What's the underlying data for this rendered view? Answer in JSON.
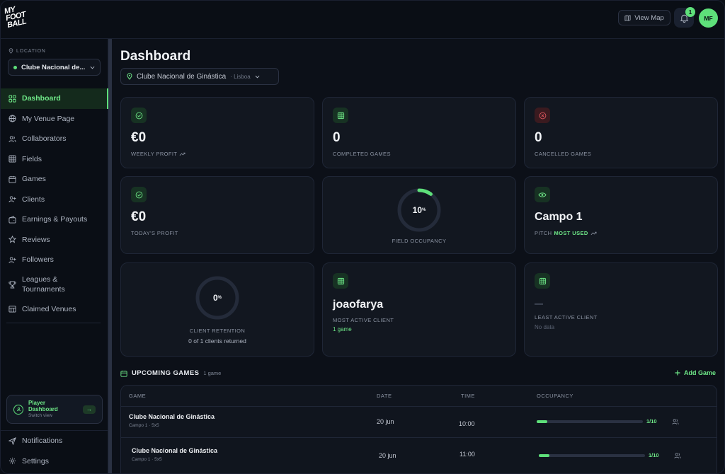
{
  "brand": {
    "logo_lines": [
      "MY",
      "FOOT",
      "BALL"
    ]
  },
  "topbar": {
    "view_map_label": "View Map",
    "notification_count": "1",
    "avatar_initials": "MF"
  },
  "sidebar": {
    "location_label": "LOCATION",
    "location_value": "Clube Nacional de...",
    "items": [
      {
        "label": "Dashboard",
        "icon": "grid-icon"
      },
      {
        "label": "My Venue Page",
        "icon": "globe-icon"
      },
      {
        "label": "Collaborators",
        "icon": "users-icon"
      },
      {
        "label": "Fields",
        "icon": "table-icon"
      },
      {
        "label": "Games",
        "icon": "calendar-icon"
      },
      {
        "label": "Clients",
        "icon": "user-plus-icon"
      },
      {
        "label": "Earnings & Payouts",
        "icon": "wallet-icon"
      },
      {
        "label": "Reviews",
        "icon": "star-icon"
      },
      {
        "label": "Followers",
        "icon": "user-add-icon"
      },
      {
        "label": "Leagues & Tournaments",
        "icon": "trophy-icon"
      },
      {
        "label": "Claimed Venues",
        "icon": "building-icon"
      }
    ],
    "player_card": {
      "title_line1": "Player",
      "title_line2": "Dashboard",
      "subtitle": "Switch view",
      "arrow": "→"
    },
    "bottom_items": [
      {
        "label": "Notifications",
        "icon": "send-icon"
      },
      {
        "label": "Settings",
        "icon": "gear-icon"
      }
    ]
  },
  "main": {
    "title": "Dashboard",
    "venue_name": "Clube Nacional de Ginástica",
    "venue_city": "· Lisboa",
    "cards": {
      "weekly_profit": {
        "value": "€0",
        "label": "WEEKLY PROFIT"
      },
      "completed_games": {
        "value": "0",
        "label": "COMPLETED GAMES"
      },
      "cancelled_games": {
        "value": "0",
        "label": "CANCELLED GAMES"
      },
      "todays_profit": {
        "value": "€0",
        "label": "TODAY'S PROFIT"
      },
      "field_occupancy": {
        "value": "10",
        "unit": "%",
        "fraction": 0.1,
        "label": "FIELD OCCUPANCY"
      },
      "most_used_pitch": {
        "value": "Campo 1",
        "label_prefix": "PITCH",
        "label_highlight": "MOST USED"
      },
      "client_retention": {
        "value": "0",
        "unit": "%",
        "fraction": 0,
        "label": "CLIENT RETENTION",
        "sub": "0 of 1 clients returned"
      },
      "most_active_client": {
        "value": "joaofarya",
        "label": "MOST ACTIVE CLIENT",
        "sub": "1 game"
      },
      "least_active_client": {
        "value": "—",
        "label": "LEAST ACTIVE CLIENT",
        "sub": "No data"
      }
    },
    "upcoming": {
      "title": "UPCOMING GAMES",
      "count": "1 game",
      "add_label": "Add Game",
      "columns": [
        "GAME",
        "DATE",
        "TIME",
        "OCCUPANCY"
      ],
      "rows": [
        {
          "game": "Clube Nacional de Ginástica",
          "field": "Campo 1 · 5x5",
          "date": "20 jun",
          "time": "10:00",
          "occupancy": "1/10",
          "fraction": 0.1
        },
        {
          "game": "Clube Nacional de Ginástica",
          "field": "Campo 1 · 5x5",
          "date": "20 jun",
          "time": "11:00",
          "occupancy": "1/10",
          "fraction": 0.1
        }
      ]
    }
  },
  "colors": {
    "accent": "#5ee07a",
    "danger": "#e0565e",
    "background": "#0c1018",
    "card": "#121720"
  }
}
